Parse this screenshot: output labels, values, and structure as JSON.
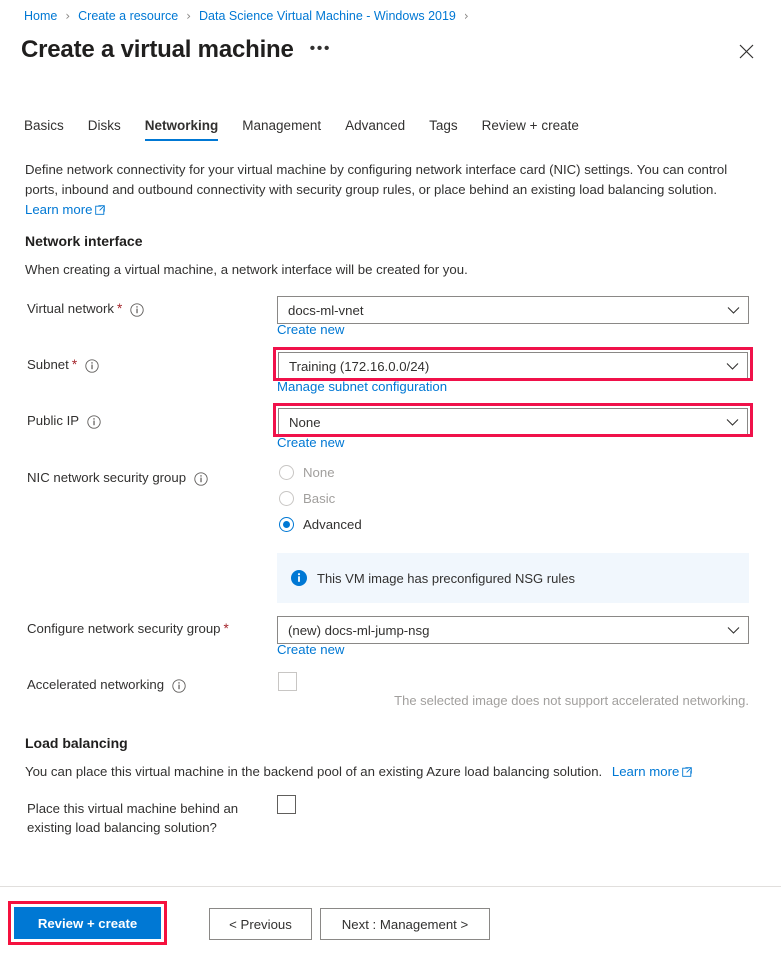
{
  "breadcrumb": {
    "items": [
      {
        "label": "Home"
      },
      {
        "label": "Create a resource"
      },
      {
        "label": "Data Science Virtual Machine - Windows 2019"
      }
    ],
    "separator": "›"
  },
  "header": {
    "title": "Create a virtual machine",
    "more_label": "•••",
    "close_icon": "close-icon"
  },
  "tabs": [
    {
      "label": "Basics",
      "active": false
    },
    {
      "label": "Disks",
      "active": false
    },
    {
      "label": "Networking",
      "active": true
    },
    {
      "label": "Management",
      "active": false
    },
    {
      "label": "Advanced",
      "active": false
    },
    {
      "label": "Tags",
      "active": false
    },
    {
      "label": "Review + create",
      "active": false
    }
  ],
  "description": {
    "line1": "Define network connectivity for your virtual machine by configuring network interface card (NIC) settings. You can control",
    "line2": "ports, inbound and outbound connectivity with security group rules, or place behind an existing load balancing solution.",
    "learn_more": "Learn more"
  },
  "network_interface": {
    "heading": "Network interface",
    "subtext": "When creating a virtual machine, a network interface will be created for you.",
    "virtual_network": {
      "label": "Virtual network",
      "required": "*",
      "value": "docs-ml-vnet",
      "sublink": "Create new"
    },
    "subnet": {
      "label": "Subnet",
      "required": "*",
      "value": "Training (172.16.0.0/24)",
      "sublink": "Manage subnet configuration"
    },
    "public_ip": {
      "label": "Public IP",
      "value": "None",
      "sublink": "Create new"
    },
    "nic_nsg": {
      "label": "NIC network security group",
      "options": [
        {
          "label": "None",
          "selected": false,
          "disabled": true
        },
        {
          "label": "Basic",
          "selected": false,
          "disabled": true
        },
        {
          "label": "Advanced",
          "selected": true,
          "disabled": false
        }
      ]
    },
    "nsg_banner": {
      "text": "This VM image has preconfigured NSG rules",
      "icon": "info-icon"
    },
    "configure_nsg": {
      "label": "Configure network security group",
      "required": "*",
      "value": "(new) docs-ml-jump-nsg",
      "sublink": "Create new"
    },
    "accelerated_networking": {
      "label": "Accelerated networking",
      "checked": false,
      "note": "The selected image does not support accelerated networking."
    }
  },
  "load_balancing": {
    "heading": "Load balancing",
    "subtext": "You can place this virtual machine in the backend pool of an existing Azure load balancing solution.",
    "learn_more": "Learn more",
    "place_behind": {
      "label_line1": "Place this virtual machine behind an",
      "label_line2": "existing load balancing solution?",
      "checked": false
    }
  },
  "footer": {
    "review_create": "Review + create",
    "previous": "< Previous",
    "next": "Next : Management >"
  },
  "colors": {
    "accent": "#0078d4",
    "link": "#0078d4",
    "required_asterisk": "#a4262c",
    "highlight_magenta": "#f0114a",
    "highlight_red": "#f5113e",
    "banner_bg": "#f1f7fd",
    "muted_text": "#a19f9d"
  }
}
